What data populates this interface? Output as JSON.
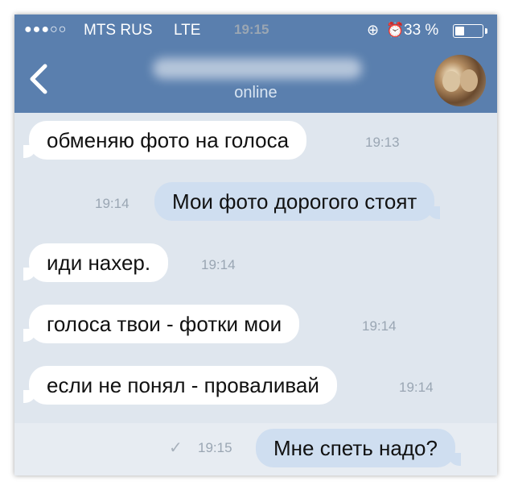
{
  "status_bar": {
    "signal_dots": "●●●○○",
    "carrier": "MTS RUS",
    "network": "LTE",
    "time": "19:15",
    "lock_icon": "⊕",
    "alarm_icon": "⏰",
    "battery_percent": "33 %",
    "battery_level": 0.33
  },
  "header": {
    "contact_name": "",
    "status": "online"
  },
  "messages": [
    {
      "direction": "in",
      "text": "обменяю фото на голоса",
      "time": "19:13"
    },
    {
      "direction": "out",
      "text": "Мои фото дорогого стоят",
      "time": "19:14"
    },
    {
      "direction": "in",
      "text": "иди нахер.",
      "time": "19:14"
    },
    {
      "direction": "in",
      "text": "голоса твои - фотки мои",
      "time": "19:14"
    },
    {
      "direction": "in",
      "text": "если не понял - проваливай",
      "time": "19:14"
    },
    {
      "direction": "out",
      "text": "Мне спеть надо?",
      "time": "19:15",
      "delivered_mark": "✓"
    }
  ],
  "colors": {
    "header": "#5a7fae",
    "chat_background": "#dfe6ee",
    "incoming_bubble": "#ffffff",
    "outgoing_bubble": "#cfdef0"
  }
}
